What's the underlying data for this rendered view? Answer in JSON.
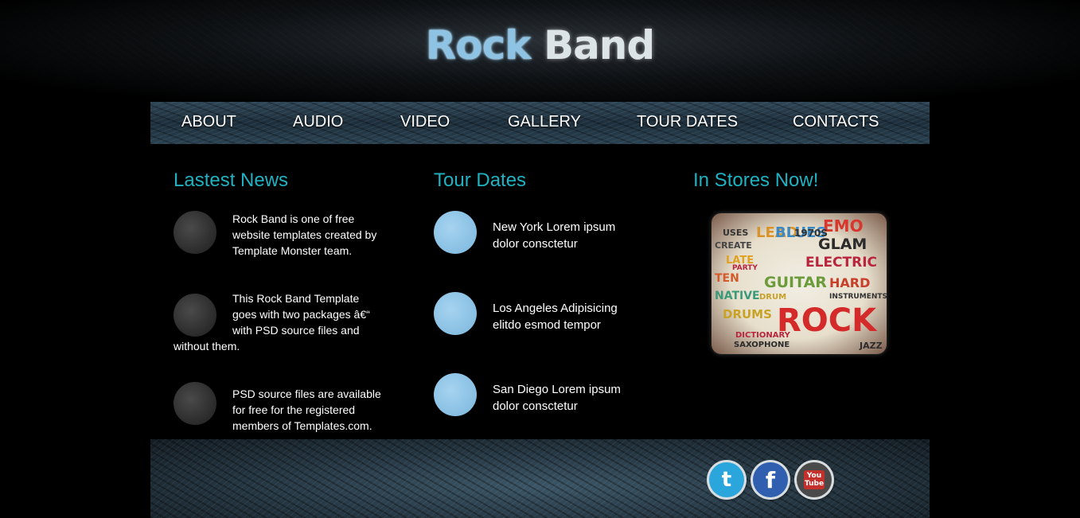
{
  "header": {
    "logo_word1": "Rock",
    "logo_word2": "Band"
  },
  "nav": {
    "items": [
      {
        "label": "ABOUT"
      },
      {
        "label": "AUDIO"
      },
      {
        "label": "VIDEO"
      },
      {
        "label": "GALLERY"
      },
      {
        "label": "TOUR DATES"
      },
      {
        "label": "CONTACTS"
      }
    ]
  },
  "news": {
    "title": "Lastest News",
    "items": [
      {
        "text": "Rock Band is one of free website templates created by Template Monster team."
      },
      {
        "text": "This Rock Band Template goes with two packages â€“ with PSD source files and without them."
      },
      {
        "text": "PSD source files are available for free for the registered members of Templates.com."
      }
    ]
  },
  "tour": {
    "title": "Tour Dates",
    "items": [
      {
        "text": "New York Lorem ipsum dolor consctetur"
      },
      {
        "text": "Los Angeles Adipisicing elitdo esmod tempor"
      },
      {
        "text": "San Diego Lorem ipsum dolor consctetur"
      }
    ]
  },
  "stores": {
    "title": "In Stores Now!",
    "album_words": [
      "EMO",
      "GLAM",
      "ELECTRIC",
      "GUITAR",
      "HARD",
      "ROCK",
      "LEAD",
      "BLUES",
      "1970S",
      "DRUMS",
      "NATIVE",
      "LATE",
      "TEN",
      "USES",
      "CREATE",
      "DICTIONARY",
      "SAXOPHONE",
      "JAZZ",
      "DRUM",
      "PARTY",
      "INSTRUMENTS"
    ]
  },
  "social": {
    "twitter_glyph": "t",
    "facebook_glyph": "f",
    "youtube_glyph": "You Tube"
  },
  "colors": {
    "accent": "#1fb2c2",
    "tour_circle": "#8ec6e8",
    "news_circle": "#333333"
  }
}
